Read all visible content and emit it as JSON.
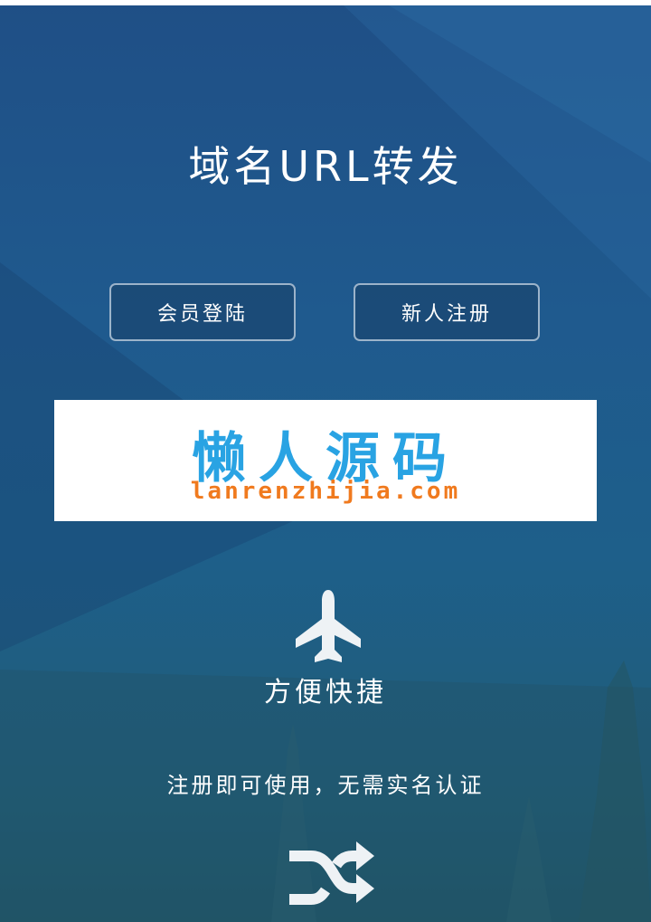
{
  "page": {
    "title": "域名URL转发"
  },
  "actions": {
    "login_label": "会员登陆",
    "register_label": "新人注册"
  },
  "banner": {
    "name": "懒人源码",
    "domain": "lanrenzhijia.com"
  },
  "features": [
    {
      "icon": "airplane-icon",
      "title": "方便快捷",
      "description": "注册即可使用，无需实名认证"
    },
    {
      "icon": "shuffle-icon"
    }
  ],
  "colors": {
    "background_top": "#1f4f86",
    "background_bottom": "#1f5668",
    "banner_name": "#29a3e3",
    "banner_domain": "#f07a1e",
    "text": "#ffffff"
  }
}
